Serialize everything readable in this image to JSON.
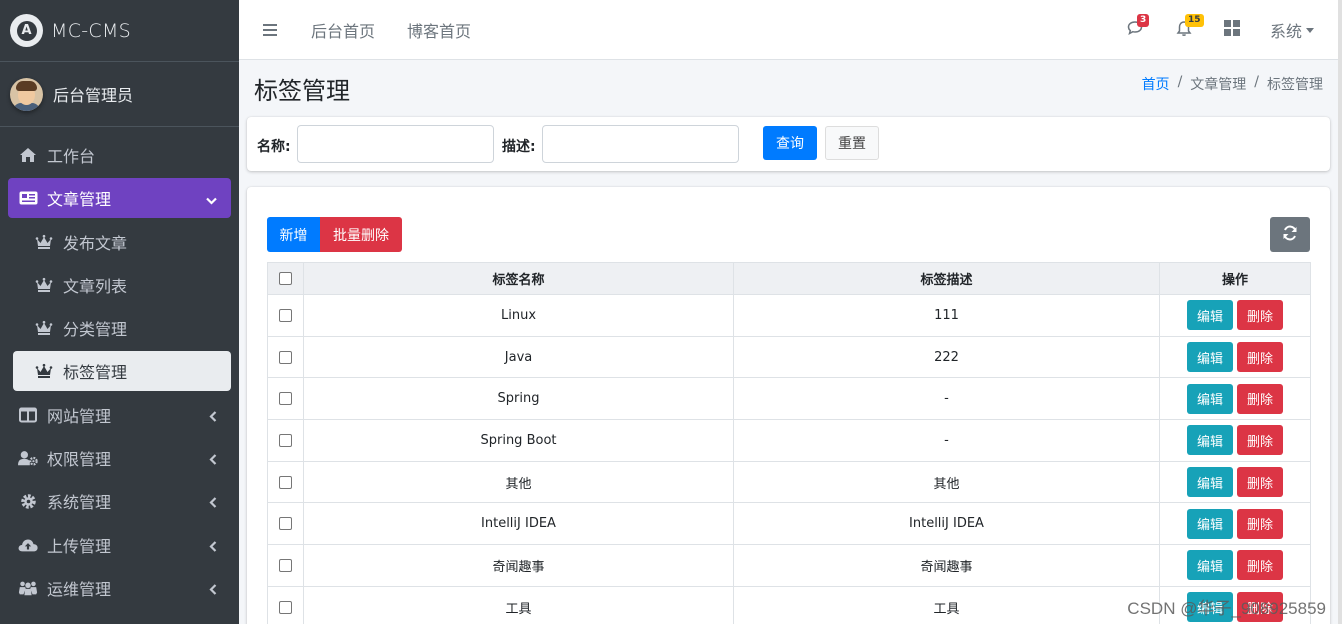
{
  "brand": {
    "logo_letter": "A",
    "name": "MC-CMS"
  },
  "user": {
    "name": "后台管理员"
  },
  "sidebar": {
    "items": [
      {
        "label": "工作台",
        "icon": "home-icon"
      },
      {
        "label": "文章管理",
        "icon": "newspaper-icon",
        "active": true
      },
      {
        "label": "发布文章",
        "icon": "crown-icon",
        "sub": true
      },
      {
        "label": "文章列表",
        "icon": "crown-icon",
        "sub": true
      },
      {
        "label": "分类管理",
        "icon": "crown-icon",
        "sub": true
      },
      {
        "label": "标签管理",
        "icon": "crown-icon",
        "sub": true,
        "selected": true
      },
      {
        "label": "网站管理",
        "icon": "columns-icon"
      },
      {
        "label": "权限管理",
        "icon": "user-cog-icon"
      },
      {
        "label": "系统管理",
        "icon": "cog-icon"
      },
      {
        "label": "上传管理",
        "icon": "cloud-upload-icon"
      },
      {
        "label": "运维管理",
        "icon": "users-icon"
      }
    ]
  },
  "topbar": {
    "links": [
      "后台首页",
      "博客首页"
    ],
    "messages_count": "3",
    "notifications_count": "15",
    "system_menu": "系统"
  },
  "page": {
    "title": "标签管理",
    "breadcrumb": [
      "首页",
      "文章管理",
      "标签管理"
    ]
  },
  "search": {
    "name_label": "名称:",
    "name_value": "",
    "desc_label": "描述:",
    "desc_value": "",
    "query_button": "查询",
    "reset_button": "重置"
  },
  "toolbar": {
    "add_button": "新增",
    "batch_delete_button": "批量删除"
  },
  "table": {
    "columns": [
      "标签名称",
      "标签描述",
      "操作"
    ],
    "edit_label": "编辑",
    "delete_label": "删除",
    "rows": [
      {
        "name": "Linux",
        "desc": "111"
      },
      {
        "name": "Java",
        "desc": "222"
      },
      {
        "name": "Spring",
        "desc": "-"
      },
      {
        "name": "Spring Boot",
        "desc": "-"
      },
      {
        "name": "其他",
        "desc": "其他"
      },
      {
        "name": "IntelliJ IDEA",
        "desc": "IntelliJ IDEA"
      },
      {
        "name": "奇闻趣事",
        "desc": "奇闻趣事"
      },
      {
        "name": "工具",
        "desc": "工具"
      }
    ]
  },
  "watermark": "CSDN @华子_908925859",
  "colors": {
    "accent": "#6f42c1",
    "primary": "#007bff",
    "danger": "#dc3545",
    "info": "#17a2b8",
    "sidebar_bg": "#343a40"
  }
}
